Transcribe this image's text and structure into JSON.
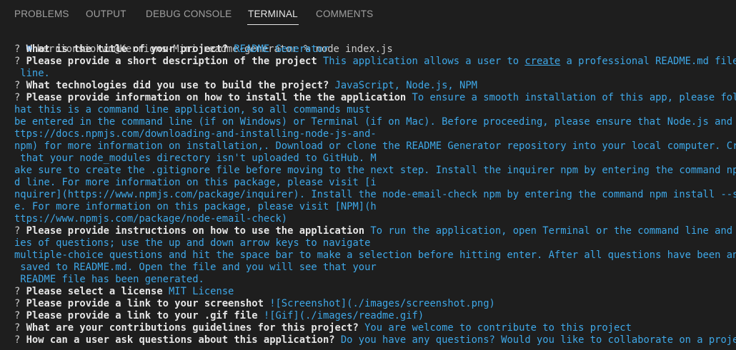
{
  "tabs": [
    {
      "label": "PROBLEMS",
      "active": false
    },
    {
      "label": "OUTPUT",
      "active": false
    },
    {
      "label": "DEBUG CONSOLE",
      "active": false
    },
    {
      "label": "TERMINAL",
      "active": true
    },
    {
      "label": "COMMENTS",
      "active": false
    }
  ],
  "terminal": {
    "prompt": "kerrionsiokwu@Kerrions-Mini readme-generator % node index.js",
    "lines": [
      {
        "q": "? ",
        "b": "What is the title of your project?",
        "a": " README Generator"
      },
      {
        "q": "? ",
        "b": "Please provide a short description of the project",
        "a": " This application allows a user to ",
        "u": "create",
        "a2": " a professional README.md file dyna"
      },
      {
        "a": " line."
      },
      {
        "q": "? ",
        "b": "What technologies did you use to build the project?",
        "a": " JavaScript, Node.js, NPM"
      },
      {
        "q": "? ",
        "b": "Please provide information on how to install the the application",
        "a": " To ensure a smooth installation of this app, please follow t"
      },
      {
        "a": "hat this is a command line application, so all commands must"
      },
      {
        "a": "be entered in the command line (if on Windows) or Terminal (if on Mac). Before proceeding, please ensure that Node.js and npm a"
      },
      {
        "a": "ttps://docs.npmjs.com/downloading-and-installing-node-js-and-"
      },
      {
        "a": "npm) for more information on installation,. Download or clone the README Generator repository into your local computer. Create"
      },
      {
        "a": " that your node_modules directory isn't uploaded to GitHub. M"
      },
      {
        "a": "ake sure to create the .gitignore file before moving to the next step. Install the inquirer npm by entering the command npm ins"
      },
      {
        "a": "d line. For more information on this package, please visit [i"
      },
      {
        "a": "nquirer](https://www.npmjs.com/package/inquirer). Install the node-email-check npm by entering the command npm install --save n"
      },
      {
        "a": "e. For more information on this package, please visit [NPM](h"
      },
      {
        "a": "ttps://www.npmjs.com/package/node-email-check)"
      },
      {
        "q": "? ",
        "b": "Please provide instructions on how to use the application",
        "a": " To run the application, open Terminal or the command line and type"
      },
      {
        "a": "ies of questions; use the up and down arrow keys to navigate"
      },
      {
        "a": "multiple-choice questions and hit the space bar to make a selection before hitting enter. After all questions have been answere"
      },
      {
        "a": " saved to README.md. Open the file and you will see that your"
      },
      {
        "a": " README file has been generated."
      },
      {
        "q": "? ",
        "b": "Please select a license",
        "a": " MIT License"
      },
      {
        "q": "? ",
        "b": "Please provide a link to your screenshot",
        "a": " ![Screenshot](./images/screenshot.png)"
      },
      {
        "q": "? ",
        "b": "Please provide a link to your .gif file",
        "a": " ![Gif](./images/readme.gif)"
      },
      {
        "q": "? ",
        "b": "What are your contributions guidelines for this project?",
        "a": " You are welcome to contribute to this project"
      },
      {
        "q": "? ",
        "b": "How can a user ask questions about this application?",
        "a": " Do you have any questions? Would you like to collaborate on a project?"
      }
    ]
  },
  "colors": {
    "background": "#1e1e1e",
    "answer": "#3ea8e8",
    "status_dot": "#3c8de6"
  }
}
